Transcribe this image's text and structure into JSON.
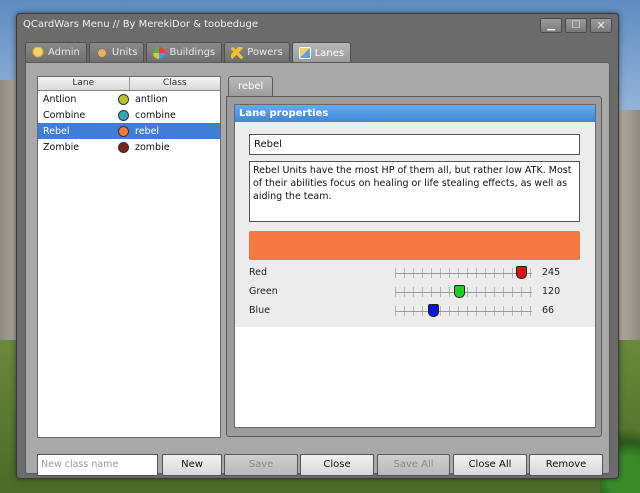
{
  "window": {
    "title": "QCardWars Menu   //  By MerekiDor & toobeduge",
    "minimize_glyph": "▁",
    "maximize_glyph": "☐",
    "close_glyph": "✕"
  },
  "tabs": [
    {
      "label": "Admin",
      "icon": "shield-icon"
    },
    {
      "label": "Units",
      "icon": "face-icon"
    },
    {
      "label": "Buildings",
      "icon": "buildings-icon"
    },
    {
      "label": "Powers",
      "icon": "lightning-icon"
    },
    {
      "label": "Lanes",
      "icon": "lanes-icon",
      "active": true
    }
  ],
  "lane_list": {
    "columns": [
      "Lane",
      "Class"
    ],
    "rows": [
      {
        "lane": "Antlion",
        "class": "antlion",
        "color": "#b5c42a"
      },
      {
        "lane": "Combine",
        "class": "combine",
        "color": "#35a6b7"
      },
      {
        "lane": "Rebel",
        "class": "rebel",
        "color": "#f57842",
        "selected": true
      },
      {
        "lane": "Zombie",
        "class": "zombie",
        "color": "#7a2418"
      }
    ]
  },
  "lane_tab": {
    "label": "rebel"
  },
  "lane_properties": {
    "header": "Lane properties",
    "name_value": "Rebel",
    "description": "Rebel Units have the most HP of them all, but rather low ATK. Most of their abilities focus on healing or life stealing effects, as well as aiding the team.",
    "swatch_color": "#f57842",
    "sliders": [
      {
        "label": "Red",
        "value": 245,
        "thumb_color": "#e01010"
      },
      {
        "label": "Green",
        "value": 120,
        "thumb_color": "#20d020"
      },
      {
        "label": "Blue",
        "value": 66,
        "thumb_color": "#1010e0"
      }
    ]
  },
  "bottom": {
    "new_class_placeholder": "New class name",
    "new_label": "New",
    "save_label": "Save",
    "close_label": "Close",
    "save_all_label": "Save All",
    "close_all_label": "Close All",
    "remove_label": "Remove"
  }
}
